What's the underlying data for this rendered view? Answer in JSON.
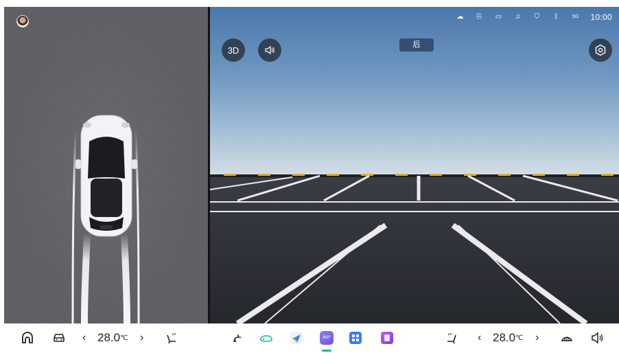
{
  "camera": {
    "view_label": "后",
    "btn_3d_label": "3D"
  },
  "status": {
    "network_label": "5G",
    "time": "10:00"
  },
  "climate": {
    "left_temp": "28.0",
    "right_temp": "28.0",
    "unit": "℃",
    "prev_arrow": "‹",
    "next_arrow": "›"
  },
  "colors": {
    "active_indicator": "#19b3a0",
    "overlay_button": "#28323f",
    "dock_bg": "#ffffff"
  },
  "dock": {
    "icons": [
      "home-icon",
      "car-icon",
      "seat-heat-left-icon",
      "fan-icon",
      "car-outline-icon",
      "nav-app-icon",
      "360-camera-icon",
      "apps-grid-icon",
      "media-app-icon",
      "seat-heat-right-icon",
      "defrost-icon",
      "volume-icon"
    ],
    "active_app": "360-camera-icon",
    "cam_360_label": "360°"
  }
}
